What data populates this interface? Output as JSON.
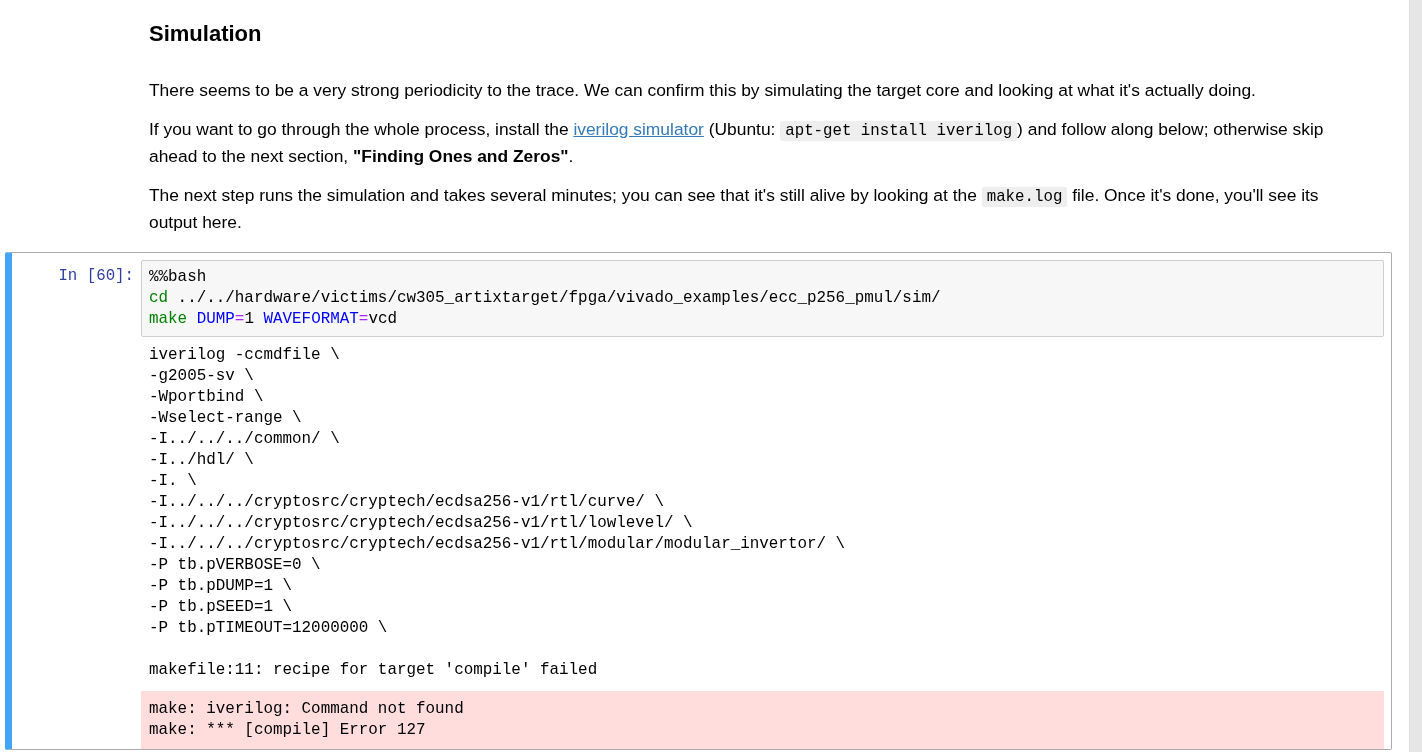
{
  "heading": "Simulation",
  "paragraphs": [
    [
      {
        "kind": "text",
        "text": "There seems to be a very strong periodicity to the trace. We can confirm this by simulating the target core and looking at what it's actually doing."
      }
    ],
    [
      {
        "kind": "text",
        "text": "If you want to go through the whole process, install the "
      },
      {
        "kind": "link",
        "text": "iverilog simulator"
      },
      {
        "kind": "text",
        "text": " (Ubuntu: "
      },
      {
        "kind": "code",
        "text": "apt-get install iverilog"
      },
      {
        "kind": "text",
        "text": ") and follow along below; otherwise skip ahead to the next section, "
      },
      {
        "kind": "bold",
        "text": "\"Finding Ones and Zeros\""
      },
      {
        "kind": "text",
        "text": "."
      }
    ],
    [
      {
        "kind": "text",
        "text": "The next step runs the simulation and takes several minutes; you can see that it's still alive by looking at the "
      },
      {
        "kind": "code",
        "text": "make.log"
      },
      {
        "kind": "text",
        "text": " file. Once it's done, you'll see its output here."
      }
    ]
  ],
  "cell": {
    "prompt": "In [60]:",
    "selected": true,
    "input": [
      [
        {
          "kind": "plain",
          "text": "%%bash"
        }
      ],
      [
        {
          "kind": "builtin",
          "text": "cd"
        },
        {
          "kind": "plain",
          "text": " ../../hardware/victims/cw305_artixtarget/fpga/vivado_examples/ecc_p256_pmul/sim/"
        }
      ],
      [
        {
          "kind": "builtin",
          "text": "make "
        },
        {
          "kind": "var",
          "text": "DUMP"
        },
        {
          "kind": "op",
          "text": "="
        },
        {
          "kind": "plain",
          "text": "1 "
        },
        {
          "kind": "var",
          "text": "WAVEFORMAT"
        },
        {
          "kind": "op",
          "text": "="
        },
        {
          "kind": "plain",
          "text": "vcd"
        }
      ]
    ],
    "output": [
      {
        "kind": "stdout",
        "lines": [
          "iverilog -ccmdfile \\",
          "-g2005-sv \\",
          "-Wportbind \\",
          "-Wselect-range \\",
          "-I../../../common/ \\",
          "-I../hdl/ \\",
          "-I. \\",
          "-I../../../cryptosrc/cryptech/ecdsa256-v1/rtl/curve/ \\",
          "-I../../../cryptosrc/cryptech/ecdsa256-v1/rtl/lowlevel/ \\",
          "-I../../../cryptosrc/cryptech/ecdsa256-v1/rtl/modular/modular_invertor/ \\",
          "-P tb.pVERBOSE=0 \\",
          "-P tb.pDUMP=1 \\",
          "-P tb.pSEED=1 \\",
          "-P tb.pTIMEOUT=12000000 \\"
        ]
      },
      {
        "kind": "stdout",
        "lines": [
          "makefile:11: recipe for target 'compile' failed"
        ]
      },
      {
        "kind": "stderr",
        "lines": [
          "make: iverilog: Command not found",
          "make: *** [compile] Error 127"
        ]
      }
    ]
  }
}
